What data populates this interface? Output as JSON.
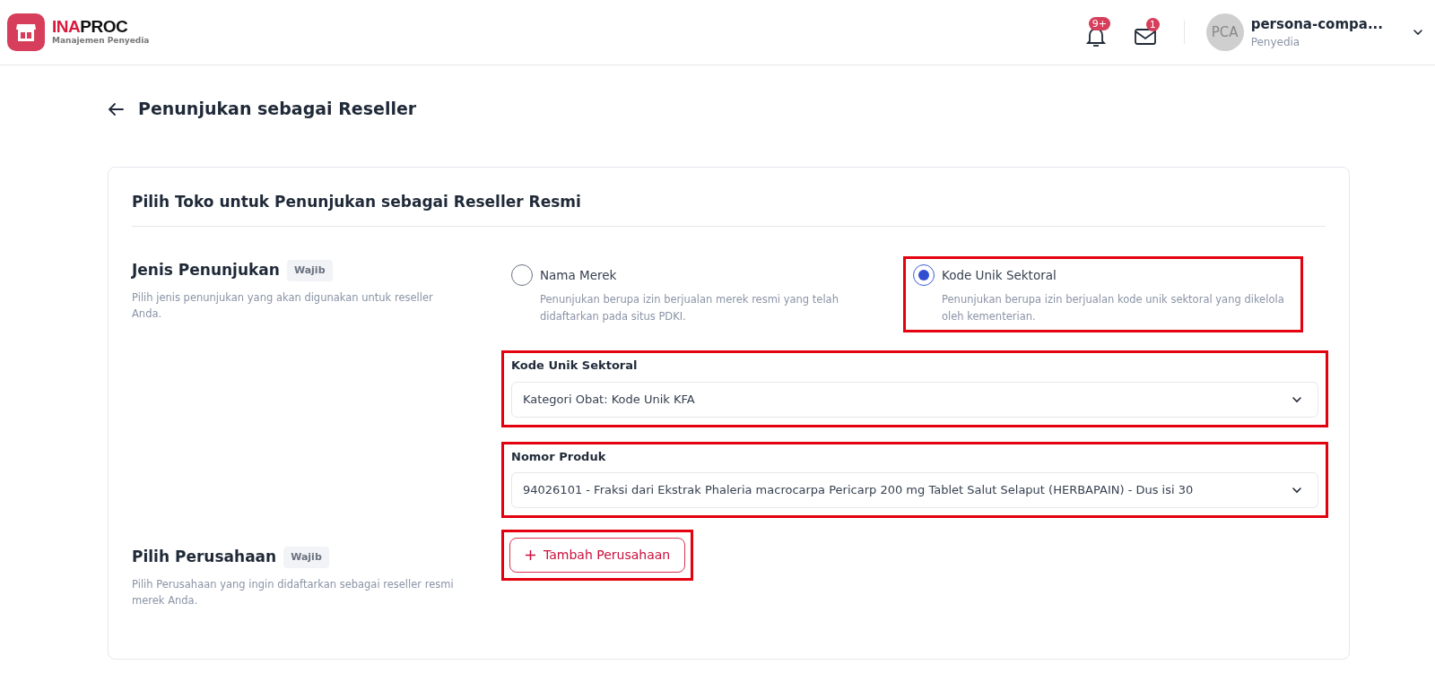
{
  "header": {
    "logo": {
      "brand_part1": "INA",
      "brand_part2": "PROC",
      "subtitle": "Manajemen Penyedia"
    },
    "notifications": {
      "badge": "9+"
    },
    "messages": {
      "badge": "1"
    },
    "user": {
      "initials": "PCA",
      "name": "persona-compa...",
      "role": "Penyedia"
    }
  },
  "page_title": "Penunjukan sebagai Reseller",
  "card": {
    "title": "Pilih Toko untuk Penunjukan sebagai Reseller Resmi",
    "sections": [
      {
        "kind": "radio",
        "label": "Jenis Penunjukan",
        "badge": "Wajib",
        "description": "Pilih jenis penunjukan yang akan digunakan untuk reseller Anda.",
        "options": [
          {
            "label": "Nama Merek",
            "description": "Penunjukan berupa izin berjualan merek resmi yang telah didaftarkan pada situs PDKI.",
            "selected": false,
            "highlighted": false
          },
          {
            "label": "Kode Unik Sektoral",
            "description": "Penunjukan berupa izin berjualan kode unik sektoral yang dikelola oleh kementerian.",
            "selected": true,
            "highlighted": true
          }
        ],
        "fields": [
          {
            "label": "Kode Unik Sektoral",
            "value": "Kategori Obat: Kode Unik KFA",
            "highlighted": true
          },
          {
            "label": "Nomor Produk",
            "value": "94026101 - Fraksi dari Ekstrak Phaleria macrocarpa Pericarp 200 mg Tablet Salut Selaput (HERBAPAIN) - Dus isi 30",
            "highlighted": true
          }
        ]
      },
      {
        "kind": "button",
        "label": "Pilih Perusahaan",
        "badge": "Wajib",
        "description": "Pilih Perusahaan yang ingin didaftarkan sebagai reseller resmi merek Anda.",
        "button": {
          "label": "Tambah Perusahaan",
          "highlighted": true
        }
      }
    ]
  }
}
